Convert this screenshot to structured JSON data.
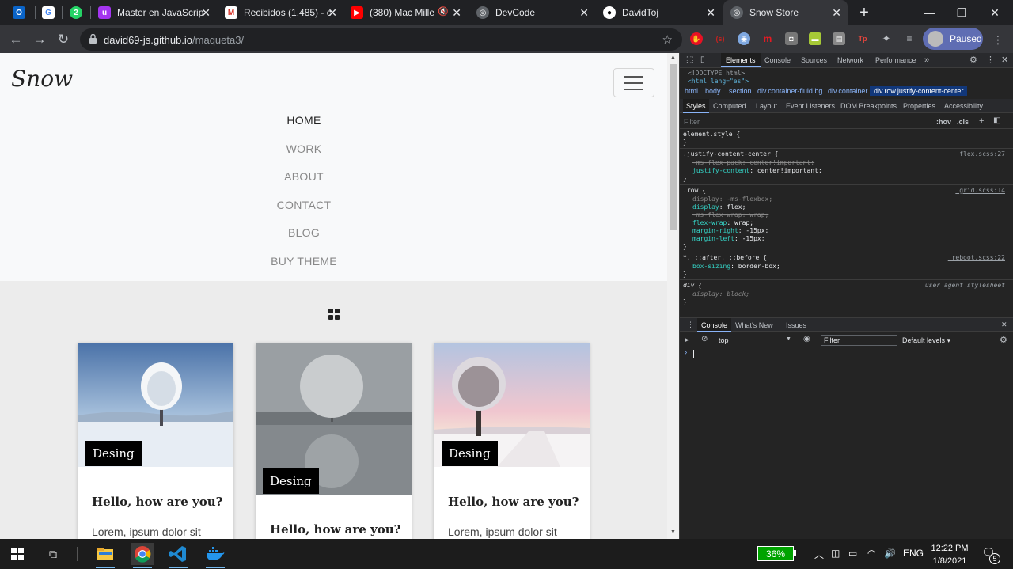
{
  "tabs": [
    {
      "title": "Master en JavaScrip",
      "icon": "udemy-icon"
    },
    {
      "title": "Recibidos (1,485) - c",
      "icon": "gmail-icon"
    },
    {
      "title": "(380) Mac Mille",
      "icon": "youtube-icon"
    },
    {
      "title": "DevCode",
      "icon": "globe-icon"
    },
    {
      "title": "DavidToj",
      "icon": "github-icon"
    },
    {
      "title": "Snow Store",
      "icon": "globe-icon"
    }
  ],
  "new_tab_symbol": "+",
  "close_symbol": "✕",
  "address": {
    "host": "david69-js.github.io",
    "path": "/maqueta3/"
  },
  "profile_label": "Paused",
  "site": {
    "logo": "Snow",
    "menu": [
      "HOME",
      "WORK",
      "ABOUT",
      "CONTACT",
      "BLOG",
      "BUY THEME"
    ],
    "cards": [
      {
        "tag": "Desing",
        "title": "Hello, how are you?",
        "text": "Lorem, ipsum dolor sit"
      },
      {
        "tag": "Desing",
        "title": "Hello, how are you?",
        "text": ""
      },
      {
        "tag": "Desing",
        "title": "Hello, how are you?",
        "text": "Lorem, ipsum dolor sit"
      }
    ]
  },
  "devtools": {
    "tabs": [
      "Elements",
      "Console",
      "Sources",
      "Network",
      "Performance",
      "»"
    ],
    "dom_lines": [
      "<!DOCTYPE html>",
      "<html lang=\"es\">"
    ],
    "breadcrumbs": [
      "html",
      "body",
      "section",
      "div.container-fluid.bg",
      "div.container",
      "div.row.justify-content-center"
    ],
    "subtabs": [
      "Styles",
      "Computed",
      "Layout",
      "Event Listeners",
      "DOM Breakpoints",
      "Properties",
      "Accessibility"
    ],
    "filter_placeholder": "Filter",
    "hov": ":hov",
    "cls": ".cls",
    "rules": {
      "element_style": "element.style {",
      "jcc_selector": ".justify-content-center {",
      "jcc_src": "_flex.scss:27",
      "jcc_l1": "-ms-flex-pack: center!important;",
      "jcc_l2_prop": "justify-content",
      "jcc_l2_val": ": center!important;",
      "row_selector": ".row {",
      "row_src": "_grid.scss:14",
      "row_l1": "display: -ms-flexbox;",
      "row_l2_prop": "display",
      "row_l2_val": ": flex;",
      "row_l3": "-ms-flex-wrap: wrap;",
      "row_l4_prop": "flex-wrap",
      "row_l4_val": ": wrap;",
      "row_l5_prop": "margin-right",
      "row_l5_val": ": -15px;",
      "row_l6_prop": "margin-left",
      "row_l6_val": ": -15px;",
      "star_selector": "*, ::after, ::before {",
      "star_src": "_reboot.scss:22",
      "star_l1_prop": "box-sizing",
      "star_l1_val": ": border-box;",
      "div_selector": "div {",
      "div_src": "user agent stylesheet",
      "div_l1": "display: block;",
      "close_brace": "}"
    },
    "drawer_tabs": [
      "Console",
      "What's New",
      "Issues"
    ],
    "console_context": "top",
    "console_filter": "Filter",
    "console_levels": "Default levels ▾",
    "prompt": "›"
  },
  "taskbar": {
    "battery": "36%",
    "lang": "ENG",
    "time": "12:22 PM",
    "date": "1/8/2021",
    "notifications": "5"
  }
}
